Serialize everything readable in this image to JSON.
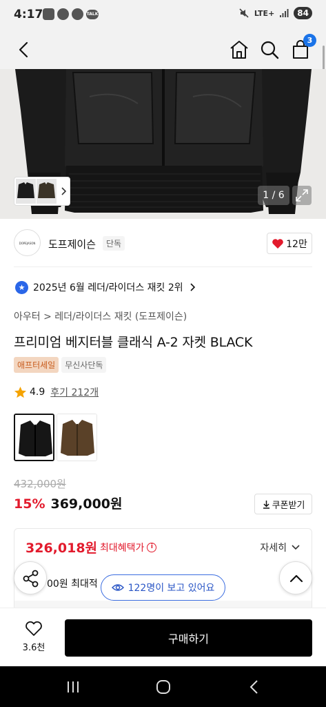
{
  "status_bar": {
    "time": "4:17",
    "network": "LTE+",
    "battery": "84",
    "icons": [
      "screenshot-icon",
      "message-icon",
      "chat-icon",
      "talk-icon",
      "mute-icon",
      "signal-icon"
    ],
    "talk_label": "TALK"
  },
  "header": {
    "cart_count": "3",
    "icons": [
      "back-arrow-icon",
      "home-icon",
      "search-icon",
      "cart-icon"
    ]
  },
  "gallery": {
    "counter": "1 / 6"
  },
  "brand": {
    "logo_text": "DOPEJASON",
    "name": "도프제이슨",
    "tag": "단독",
    "likes": "12만"
  },
  "ranking": {
    "text": "2025년 6월 레더/라이더스 재킷 2위"
  },
  "product": {
    "breadcrumb": "아우터 > 레더/라이더스 재킷 (도프제이슨)",
    "title": "프리미엄 베지터블 클래식 A-2 자켓 BLACK",
    "badges": [
      "애프터세일",
      "무신사단독"
    ],
    "rating": "4.9",
    "review_count": "후기 212개",
    "options": [
      "BLACK",
      "BROWN"
    ],
    "original_price": "432,000원",
    "discount": "15%",
    "price": "369,000원",
    "coupon_label": "쿠폰받기"
  },
  "benefit": {
    "price": "326,018원",
    "label": "최대혜택가",
    "detail_label": "자세히",
    "sub_text": "00원 최대적"
  },
  "floating": {
    "viewers": "122명이 보고 있어요"
  },
  "bottom": {
    "wish_count": "3.6천",
    "buy_label": "구매하기"
  },
  "colors": {
    "accent_red": "#e21a2c",
    "accent_blue": "#2a56c6",
    "badge_orange": "#c85d1e",
    "buy_button": "#000000"
  }
}
